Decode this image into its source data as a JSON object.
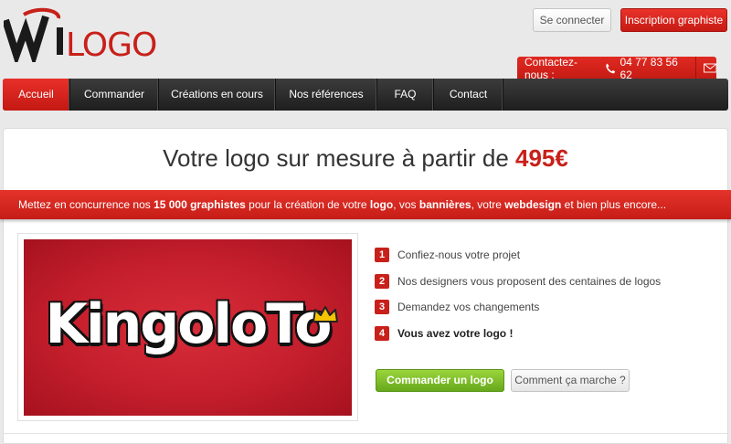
{
  "header": {
    "logo_text": "WiLOGO",
    "login_label": "Se connecter",
    "signup_label": "Inscription graphiste",
    "contact_label": "Contactez-nous :",
    "phone": "04 77 83 56 62"
  },
  "nav": {
    "items": [
      {
        "label": "Accueil",
        "active": true
      },
      {
        "label": "Commander"
      },
      {
        "label": "Créations en cours"
      },
      {
        "label": "Nos références"
      },
      {
        "label": "FAQ"
      },
      {
        "label": "Contact"
      }
    ]
  },
  "hero": {
    "headline": "Votre logo sur mesure à partir de",
    "price": "495€"
  },
  "ribbon": {
    "p1": "Mettez en concurrence nos ",
    "b1": "15 000 graphistes",
    "p2": " pour la création de votre ",
    "b2": "logo",
    "p3": ", vos ",
    "b3": "bannières",
    "p4": ", votre ",
    "b4": "webdesign",
    "p5": " et bien plus encore..."
  },
  "showcase": {
    "logo_text": "KingoloTo"
  },
  "steps": [
    {
      "num": "1",
      "text": "Confiez-nous votre projet"
    },
    {
      "num": "2",
      "text": "Nos designers vous proposent des centaines de logos"
    },
    {
      "num": "3",
      "text": "Demandez vos changements"
    },
    {
      "num": "4",
      "text": "Vous avez votre logo !"
    }
  ],
  "actions": {
    "order_label": "Commander un logo",
    "how_label": "Comment ça marche ?"
  },
  "colors": {
    "brand_red": "#c8201a",
    "nav_dark": "#2a2a2a",
    "order_green": "#7cbc2a"
  }
}
